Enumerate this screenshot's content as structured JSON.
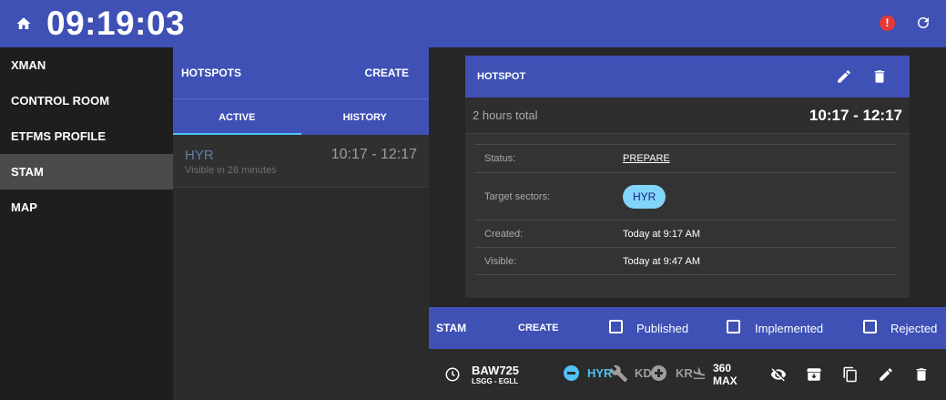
{
  "header": {
    "clock": "09:19:03",
    "alert_glyph": "!"
  },
  "sidebar": {
    "items": [
      "XMAN",
      "CONTROL ROOM",
      "ETFMS PROFILE",
      "STAM",
      "MAP"
    ]
  },
  "hotspots": {
    "title": "HOTSPOTS",
    "create_label": "CREATE",
    "tabs": [
      "ACTIVE",
      "HISTORY"
    ],
    "item": {
      "name": "HYR",
      "time": "10:17 - 12:17",
      "subtitle": "Visible in 28 minutes"
    }
  },
  "detail": {
    "title": "HOTSPOT",
    "total_label": "2 hours total",
    "total_range": "10:17 - 12:17",
    "status_label": "Status:",
    "status_value": "PREPARE",
    "sectors_label": "Target sectors:",
    "sector_chip": "HYR",
    "created_label": "Created:",
    "created_value": "Today at 9:17 AM",
    "visible_label": "Visible:",
    "visible_value": "Today at 9:47 AM"
  },
  "stam": {
    "title": "STAM",
    "create_label": "CREATE",
    "checkboxes": [
      "Published",
      "Implemented",
      "Rejected"
    ]
  },
  "flight": {
    "callsign": "BAW725",
    "route": "LSGG - EGLL",
    "sector1": "HYR",
    "sector2": "KD",
    "sector3": "KR",
    "fl_top": "360",
    "fl_bottom": "MAX"
  },
  "colors": {
    "primary": "#3f51b5",
    "accent": "#4fc3f7",
    "alert": "#e53935"
  }
}
